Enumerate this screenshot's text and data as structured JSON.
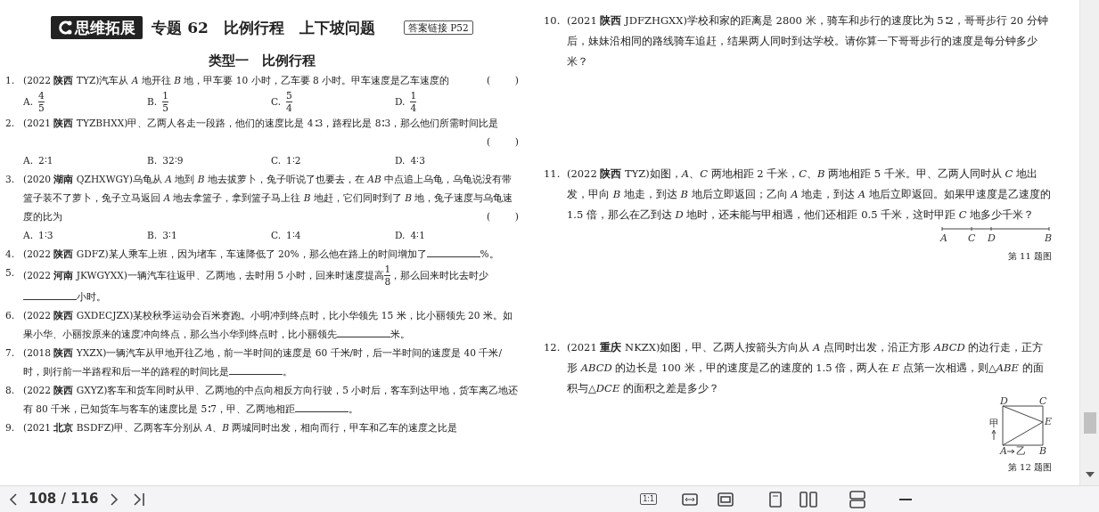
{
  "left_page": {
    "header": {
      "badge": "思维拓展",
      "title": "专题 62　比例行程　上下坡问题",
      "answer_link": "答案链接 P52"
    },
    "section": "类型一　比例行程",
    "questions": [
      {
        "number": "1.",
        "segments": [
          {
            "kind": "text",
            "text": "(2022 **陕西** TYZ)汽车从 *A* 地开往 *B* 地，甲车要 10 小时，乙车要 8 小时。甲车速度是乙车速度的"
          }
        ],
        "bracket": [
          "(",
          ")"
        ],
        "options": [
          {
            "label": "A.",
            "kind": "fraction",
            "numerator": "4",
            "denominator": "5"
          },
          {
            "label": "B.",
            "kind": "fraction",
            "numerator": "1",
            "denominator": "5"
          },
          {
            "label": "C.",
            "kind": "fraction",
            "numerator": "5",
            "denominator": "4"
          },
          {
            "label": "D.",
            "kind": "fraction",
            "numerator": "1",
            "denominator": "4"
          }
        ]
      },
      {
        "number": "2.",
        "segments": [
          {
            "kind": "text",
            "text": "(2021 **陕西** TYZBHXX)甲、乙两人各走一段路，他们的速度比是 4∶3，路程比是 8∶3，那么他们所需时间比是"
          }
        ],
        "bracket": [
          "(",
          ")"
        ],
        "options": [
          {
            "label": "A.",
            "kind": "text",
            "text": "2∶1"
          },
          {
            "label": "B.",
            "kind": "text",
            "text": "32∶9"
          },
          {
            "label": "C.",
            "kind": "text",
            "text": "1∶2"
          },
          {
            "label": "D.",
            "kind": "text",
            "text": "4∶3"
          }
        ]
      },
      {
        "number": "3.",
        "segments": [
          {
            "kind": "text",
            "text": "(2020 **湖南** QZHXWGY)乌龟从 *A* 地到 *B* 地去拔萝卜，兔子听说了也要去，在 *AB* 中点追上乌龟，乌龟说没有带篮子装不了萝卜，兔子立马返回 *A* 地去拿篮子，拿到篮子马上往 *B* 地赶，它们同时到了 *B* 地，兔子速度与乌龟速度的比为"
          }
        ],
        "bracket": [
          "(",
          ")"
        ],
        "options": [
          {
            "label": "A.",
            "kind": "text",
            "text": "1∶3"
          },
          {
            "label": "B.",
            "kind": "text",
            "text": "3∶1"
          },
          {
            "label": "C.",
            "kind": "text",
            "text": "1∶4"
          },
          {
            "label": "D.",
            "kind": "text",
            "text": "4∶1"
          }
        ]
      },
      {
        "number": "4.",
        "segments": [
          {
            "kind": "text",
            "text": "(2022 **陕西** GDFZ)某人乘车上班，因为堵车，车速降低了 20%，那么他在路上的时间增加了"
          },
          {
            "kind": "blank"
          },
          {
            "kind": "text",
            "text": "%。"
          }
        ]
      },
      {
        "number": "5.",
        "segments": [
          {
            "kind": "text",
            "text": "(2022 **河南** JKWGYXX)一辆汽车往返甲、乙两地，去时用 5 小时，回来时速度提高"
          },
          {
            "kind": "fraction",
            "numerator": "1",
            "denominator": "8"
          },
          {
            "kind": "text",
            "text": "，那么回来时比去时少"
          },
          {
            "kind": "blank"
          },
          {
            "kind": "text",
            "text": "小时。"
          }
        ]
      },
      {
        "number": "6.",
        "segments": [
          {
            "kind": "text",
            "text": "(2022 **陕西** GXDECJZX)某校秋季运动会百米赛跑。小明冲到终点时，比小华领先 15 米，比小丽领先 20 米。如果小华、小丽按原来的速度冲向终点，那么当小华到终点时，比小丽领先"
          },
          {
            "kind": "blank"
          },
          {
            "kind": "text",
            "text": "米。"
          }
        ]
      },
      {
        "number": "7.",
        "segments": [
          {
            "kind": "text",
            "text": "(2018 **陕西** YXZX)一辆汽车从甲地开往乙地，前一半时间的速度是 60 千米/时，后一半时间的速度是 40 千米/时，则行前一半路程和后一半的路程的时间比是"
          },
          {
            "kind": "blank"
          },
          {
            "kind": "text",
            "text": "。"
          }
        ]
      },
      {
        "number": "8.",
        "segments": [
          {
            "kind": "text",
            "text": "(2022 **陕西** GXYZ)客车和货车同时从甲、乙两地的中点向相反方向行驶，5 小时后，客车到达甲地，货车离乙地还有 80 千米，已知货车与客车的速度比是 5∶7，甲、乙两地相距"
          },
          {
            "kind": "blank"
          },
          {
            "kind": "text",
            "text": "。"
          }
        ]
      },
      {
        "number": "9.",
        "segments": [
          {
            "kind": "text",
            "text": "(2021 **北京** BSDFZ)甲、乙两客车分别从 *A*、*B* 两城同时出发，相向而行，甲车和乙车的速度之比是"
          }
        ]
      }
    ]
  },
  "right_page": {
    "questions": [
      {
        "number": "10.",
        "segments": [
          {
            "kind": "text",
            "text": "(2021 **陕西** JDFZHGXX)学校和家的距离是 2800 米，骑车和步行的速度比为 5∶2，哥哥步行 20 分钟后，妹妹沿相同的路线骑车追赶，结果两人同时到达学校。请你算一下哥哥步行的速度是每分钟多少米？"
          }
        ]
      },
      {
        "number": "11.",
        "segments": [
          {
            "kind": "text",
            "text": "(2022 **陕西** TYZ)如图，*A*、*C* 两地相距 2 千米，*C*、*B* 两地相距 5 千米。甲、乙两人同时从 *C* 地出发，甲向 *B* 地走，到达 *B* 地后立即返回；乙向 *A* 地走，到达 *A* 地后立即返回。如果甲速度是乙速度的 1.5 倍，那么在乙到达 *D* 地时，还未能与甲相遇，他们还相距 0.5 千米，这时甲距 *C* 地多少千米？"
          }
        ],
        "figure": {
          "kind": "line",
          "labels": [
            "A",
            "C",
            "D",
            "B"
          ],
          "caption": "第 11 题图"
        }
      },
      {
        "number": "12.",
        "segments": [
          {
            "kind": "text",
            "text": "(2021 **重庆** NKZX)如图，甲、乙两人按箭头方向从 *A* 点同时出发，沿正方形 *ABCD* 的边行走，正方形 *ABCD* 的边长是 100 米，甲的速度是乙的速度的 1.5 倍，两人在 *E* 点第一次相遇，则△*ABE* 的面积与△*DCE* 的面积之差是多少？"
          }
        ],
        "figure": {
          "kind": "square",
          "labels": [
            "D",
            "C",
            "E",
            "甲",
            "A",
            "乙",
            "B"
          ],
          "caption": "第 12 题图"
        }
      }
    ]
  },
  "toolbar": {
    "page_indicator": "108 / 116",
    "actual_size": "1:1"
  }
}
